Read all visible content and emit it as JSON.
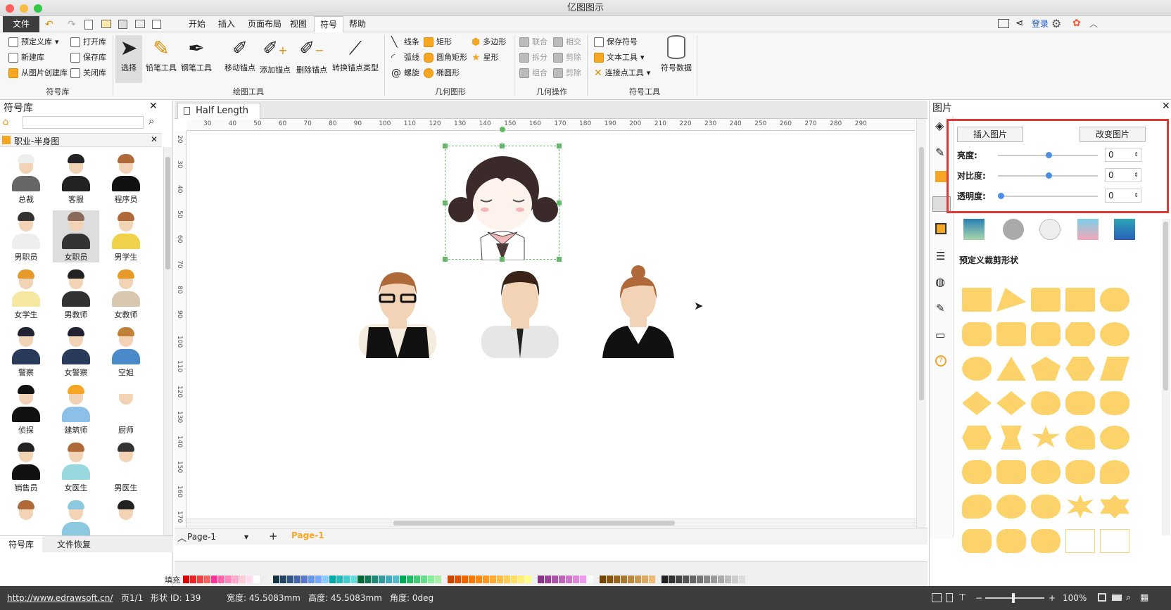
{
  "window": {
    "title": "亿图图示"
  },
  "menu": {
    "file": "文件",
    "items": [
      "开始",
      "插入",
      "页面布局",
      "视图",
      "符号",
      "帮助"
    ],
    "active_index": 4,
    "login": "登录"
  },
  "ribbon": {
    "lib_group": {
      "label": "符号库",
      "buttons": [
        "预定义库",
        "打开库",
        "新建库",
        "保存库",
        "从图片创建库",
        "关闭库"
      ]
    },
    "draw_group": {
      "label": "绘图工具",
      "buttons": [
        "选择",
        "铅笔工具",
        "钢笔工具",
        "移动锚点",
        "添加锚点",
        "删除锚点",
        "转换锚点类型"
      ]
    },
    "geo_group": {
      "label": "几何图形",
      "buttons": [
        "线条",
        "矩形",
        "多边形",
        "弧线",
        "圆角矩形",
        "星形",
        "螺旋",
        "椭圆形"
      ]
    },
    "geoop_group": {
      "label": "几何操作",
      "buttons": [
        "联合",
        "相交",
        "拆分",
        "剪除",
        "组合",
        "剪除"
      ]
    },
    "symtool_group": {
      "label": "符号工具",
      "buttons": [
        "保存符号",
        "文本工具",
        "连接点工具",
        "符号数据"
      ]
    }
  },
  "left_panel": {
    "title": "符号库",
    "category": "职业-半身图",
    "symbols": [
      "总裁",
      "客服",
      "程序员",
      "男职员",
      "女职员",
      "男学生",
      "女学生",
      "男教师",
      "女教师",
      "警察",
      "女警察",
      "空姐",
      "侦探",
      "建筑师",
      "厨师",
      "销售员",
      "女医生",
      "男医生"
    ],
    "tabs": [
      "符号库",
      "文件恢复"
    ]
  },
  "canvas": {
    "tab_title": "Half Length",
    "ruler_h": [
      "30",
      "40",
      "50",
      "60",
      "70",
      "80",
      "90",
      "100",
      "110",
      "120",
      "130",
      "140",
      "150",
      "160",
      "170",
      "180",
      "190",
      "200",
      "210",
      "220",
      "230",
      "240",
      "250",
      "260",
      "270",
      "280",
      "290"
    ],
    "ruler_v": [
      "20",
      "30",
      "40",
      "50",
      "60",
      "70",
      "80",
      "90",
      "100",
      "110",
      "120",
      "130",
      "140",
      "150",
      "160",
      "170"
    ],
    "page_tab": "Page-1",
    "page_tab_active": "Page-1",
    "fill_label": "填充"
  },
  "right_panel": {
    "title": "图片",
    "insert_btn": "插入图片",
    "change_btn": "改变图片",
    "sliders": [
      {
        "label": "亮度:",
        "value": "0",
        "fraction": 0.5
      },
      {
        "label": "对比度:",
        "value": "0",
        "fraction": 0.5
      },
      {
        "label": "透明度:",
        "value": "0",
        "fraction": 0.0
      }
    ],
    "crop_title": "预定义裁剪形状"
  },
  "status": {
    "url": "http://www.edrawsoft.cn/",
    "page": "页1/1",
    "shape_id": "形状 ID: 139",
    "width": "宽度: 45.5083mm",
    "height": "高度: 45.5083mm",
    "angle": "角度: 0deg",
    "zoom": "100%"
  },
  "colors": {
    "accent": "#f5a623",
    "highlight": "#e53935",
    "status_bg": "#3d3d3d"
  }
}
